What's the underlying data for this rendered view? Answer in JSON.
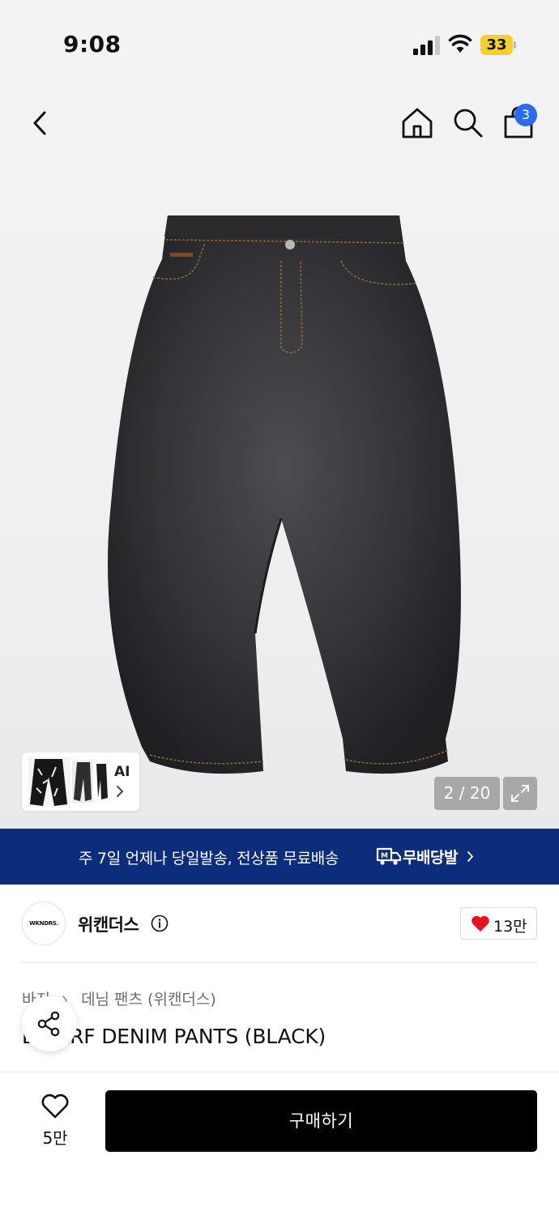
{
  "status_bar": {
    "time": "9:08",
    "battery_level": "33",
    "battery_color": "#f7cf2a"
  },
  "header": {
    "back_icon": "chevron-left-icon",
    "home_icon": "home-icon",
    "search_icon": "search-icon",
    "cart_icon": "shopping-bag-icon",
    "cart_count": "3",
    "badge_color": "#2a6bf2"
  },
  "gallery": {
    "ai_label": "AI",
    "counter": "2 / 20",
    "expand_icon": "expand-icon"
  },
  "banner": {
    "text": "주 7일 언제나 당일발송, 전상품 무료배송",
    "brand": "무배당발",
    "background": "#0b2d7b"
  },
  "brand": {
    "logo_text": "WKNDRS.",
    "name": "위캔더스",
    "like_count": "13만",
    "heart_color": "#e8121d"
  },
  "product": {
    "breadcrumb": [
      "바지",
      "데님 팬츠 (위캔더스)"
    ],
    "title": "DWARF DENIM PANTS (BLACK)"
  },
  "bottom_bar": {
    "wish_count": "5만",
    "buy_label": "구매하기"
  }
}
